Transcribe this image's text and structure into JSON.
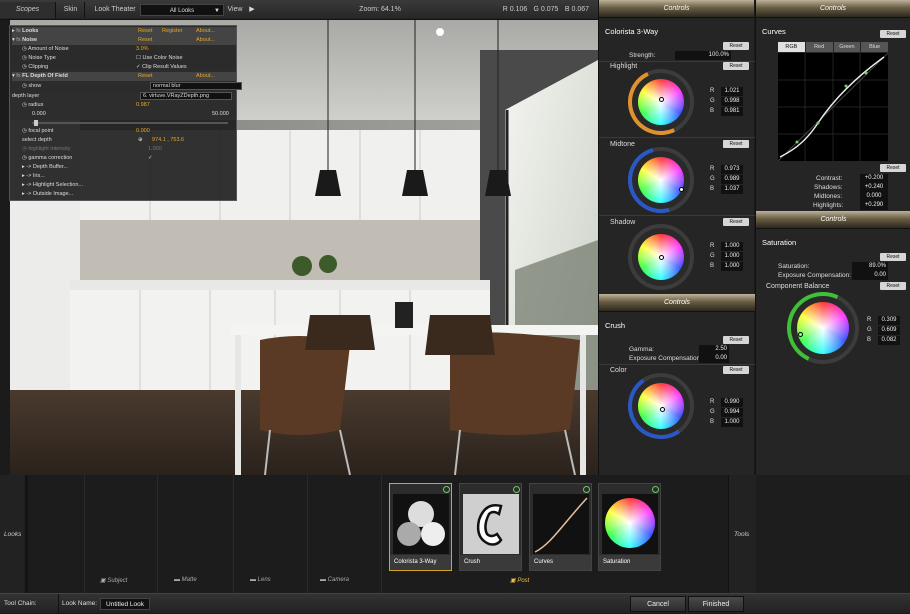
{
  "topbar": {
    "scopes": "Scopes",
    "skin": "Skin",
    "look_theater": "Look Theater",
    "looks_select": "All Looks",
    "view": "View",
    "zoom": "Zoom:  64.1%",
    "r": "R  0.106",
    "g": "G  0.075",
    "b": "B  0.067"
  },
  "overlay": {
    "rows": [
      {
        "label": "Looks",
        "links": [
          "Reset",
          "Register",
          "About..."
        ]
      },
      {
        "label": "Noise",
        "links": [
          "Reset",
          "About..."
        ]
      },
      {
        "label": "Amount of Noise",
        "value": "3.0%"
      },
      {
        "label": "Noise Type",
        "value": "Use Color Noise"
      },
      {
        "label": "Clipping",
        "value": "Clip Result Values"
      },
      {
        "label": "FL Depth Of Field",
        "links": [
          "Reset",
          "About..."
        ]
      },
      {
        "label": "show",
        "value": "normal blur"
      },
      {
        "label": "depth layer",
        "value": "6. virtuve.VRayZDepth.png"
      },
      {
        "label": "radius",
        "value": "0.987"
      },
      {
        "label": "0.000",
        "value": "50.000"
      },
      {
        "label": "focal point",
        "value": "0.000"
      },
      {
        "label": "select depth",
        "value": "974.1 , 753.6"
      },
      {
        "label": "highlight intensity",
        "value": "1.000"
      },
      {
        "label": "gamma correction",
        "value": "✓"
      },
      {
        "label": "-> Depth Buffer..."
      },
      {
        "label": "-> Iris..."
      },
      {
        "label": "-> Highlight Selection..."
      },
      {
        "label": "-> Outside Image..."
      }
    ]
  },
  "col1": {
    "header": "Controls",
    "title": "Colorista 3-Way",
    "strength_label": "Strength:",
    "strength_value": "100.0%",
    "reset": "Reset",
    "highlight": {
      "label": "Highlight",
      "r": "1.021",
      "g": "0.998",
      "b": "0.981"
    },
    "midtone": {
      "label": "Midtone",
      "r": "0.973",
      "g": "0.989",
      "b": "1.037"
    },
    "shadow": {
      "label": "Shadow",
      "r": "1.000",
      "g": "1.000",
      "b": "1.000"
    },
    "header2": "Controls",
    "crush_title": "Crush",
    "gamma_label": "Gamma:",
    "gamma_value": "2.50",
    "exp_label": "Exposure Compensation:",
    "exp_value": "0.00",
    "color": {
      "label": "Color",
      "r": "0.990",
      "g": "0.994",
      "b": "1.000"
    }
  },
  "col2": {
    "header": "Controls",
    "curves_title": "Curves",
    "reset": "Reset",
    "tabs": [
      "RGB",
      "Red",
      "Green",
      "Blue"
    ],
    "contrast_label": "Contrast:",
    "contrast_value": "+0.200",
    "shadows_label": "Shadows:",
    "shadows_value": "+0.240",
    "midtones_label": "Midtones:",
    "midtones_value": "0.000",
    "highlights_label": "Highlights:",
    "highlights_value": "+0.290",
    "header2": "Controls",
    "sat_title": "Saturation",
    "sat_label": "Saturation:",
    "sat_value": "89.0%",
    "exp_label": "Exposure Compensation:",
    "exp_value": "0.00",
    "balance": {
      "label": "Component Balance",
      "r": "0.309",
      "g": "0.609",
      "b": "0.082"
    }
  },
  "bottom": {
    "looks": "Looks",
    "tools": "Tools",
    "sections": [
      "Subject",
      "Matte",
      "Lens",
      "Camera",
      "Post"
    ],
    "cards": [
      "Colorista 3-Way",
      "Crush",
      "Curves",
      "Saturation"
    ]
  },
  "status": {
    "tool_chain": "Tool Chain:",
    "look_name_label": "Look Name:",
    "look_name": "Untitled Look",
    "cancel": "Cancel",
    "finished": "Finished"
  }
}
